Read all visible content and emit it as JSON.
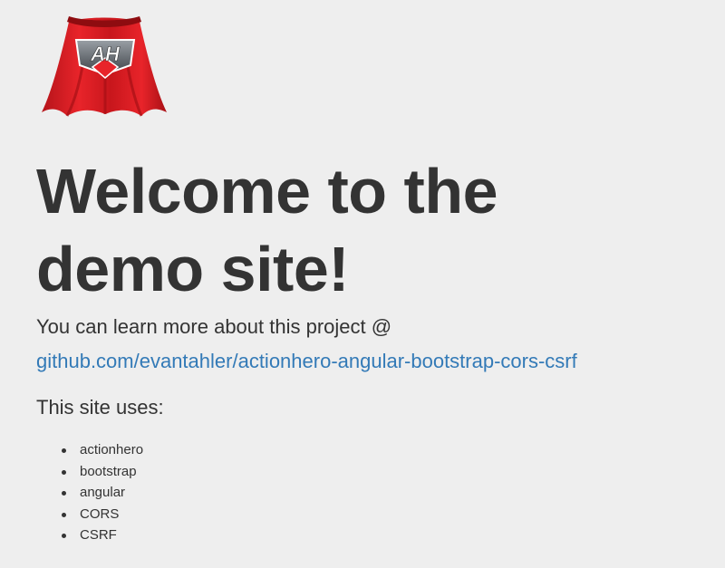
{
  "logo": {
    "text": "AH",
    "icon": "superhero-cape-logo",
    "colors": {
      "cape": "#e51c1c",
      "cape_shadow": "#a30f12",
      "badge": "#5a5f66"
    }
  },
  "hero": {
    "title": "Welcome to the demo site!"
  },
  "intro": {
    "text": "You can learn more about this project @",
    "link_text": "github.com/evantahler/actionhero-angular-bootstrap-cors-csrf"
  },
  "uses": {
    "heading": "This site uses:",
    "items": [
      "actionhero",
      "bootstrap",
      "angular",
      "CORS",
      "CSRF"
    ]
  },
  "colors": {
    "background": "#eeeeee",
    "text": "#333333",
    "link": "#337ab7"
  }
}
